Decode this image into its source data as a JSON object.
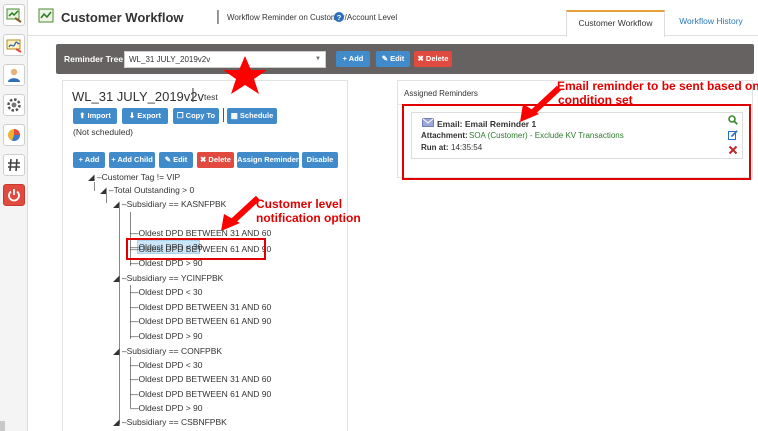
{
  "header": {
    "title": "Customer Workflow",
    "subtitle": "Workflow Reminder on Customer/Account Level",
    "tabs": [
      {
        "label": "Customer Workflow",
        "active": true
      },
      {
        "label": "Workflow History",
        "active": false
      }
    ]
  },
  "sidebar": {
    "icons": [
      "workflow-icon",
      "signature-icon",
      "user-icon",
      "settings-icon",
      "pie-chart-icon",
      "hash-icon",
      "power-icon"
    ]
  },
  "reminder_bar": {
    "label": "Reminder Tree",
    "selected_tree": "WL_31 JULY_2019v2v",
    "add_label": "+ Add",
    "edit_label": "Edit",
    "delete_label": "Delete"
  },
  "tree_panel": {
    "name": "WL_31 JULY_2019v2v",
    "description": "test",
    "import_label": "Import",
    "export_label": "Export",
    "copy_label": "Copy To",
    "schedule_label": "Schedule",
    "schedule_status": "(Not scheduled)",
    "toolbar": {
      "add": "+ Add",
      "add_child": "+ Add Child",
      "edit": "Edit",
      "delete": "Delete",
      "assign": "Assign Reminder",
      "disable": "Disable"
    },
    "nodes": {
      "root": "Customer Tag != VIP",
      "total": "Total Outstanding > 0",
      "sub1": "Subsidiary == KASNFPBK",
      "sub2": "Subsidiary == YCINFPBK",
      "sub3": "Subsidiary == CONFPBK",
      "sub4": "Subsidiary == CSBNFPBK",
      "dpd_lt30": "Oldest DPD < 30",
      "dpd_31_60": "Oldest DPD BETWEEN 31 AND 60",
      "dpd_61_90": "Oldest DPD BETWEEN 61 AND 90",
      "dpd_gt90": "Oldest DPD > 90"
    }
  },
  "assigned_panel": {
    "title": "Assigned Reminders",
    "reminder": {
      "title": "Email: Email Reminder 1",
      "attachment_label": "Attachment:",
      "attachment_value": "SOA (Customer) - Exclude KV Transactions",
      "run_label": "Run at:",
      "run_value": "14:35:54"
    }
  },
  "annotations": {
    "email_line1": "Email reminder  to be sent based on",
    "email_line2": "condition set",
    "customer_line1": "Customer level",
    "customer_line2": "notification option"
  },
  "colors": {
    "primary": "#428bca",
    "danger": "#e04a3f",
    "annotation": "#e00000",
    "tab_accent": "#e7a13a",
    "bar": "#666262"
  }
}
